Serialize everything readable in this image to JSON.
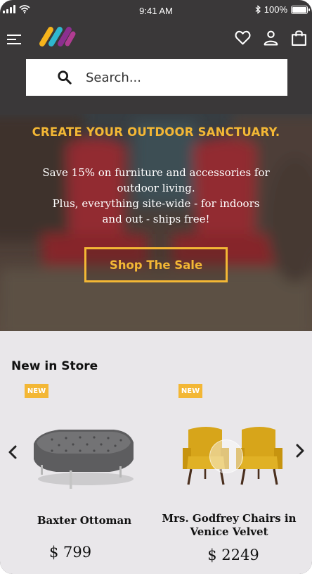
{
  "status_bar": {
    "time": "9:41 AM",
    "battery_text": "100%",
    "battery_level": 1.0
  },
  "nav": {
    "icons": [
      "menu-icon",
      "brand-logo",
      "heart-icon",
      "user-icon",
      "shopping-bag-icon"
    ]
  },
  "search": {
    "placeholder": "Search..."
  },
  "hero": {
    "title": "CREATE YOUR OUTDOOR SANCTUARY.",
    "line1": "Save 15% on furniture  and accessories for",
    "line2": "outdoor living.",
    "line3": "Plus, everything site-wide - for indoors",
    "line4": "and out - ships free!",
    "cta": "Shop The Sale"
  },
  "colors": {
    "accent": "#f3b735",
    "header_bg": "#3a3839",
    "section_bg": "#e9e7ea"
  },
  "products_section": {
    "title": "New in Store",
    "items": [
      {
        "badge": "NEW",
        "name_line1": "Baxter Ottoman",
        "name_line2": "",
        "price": "$ 799",
        "image_icon": "gray-tufted-ottoman"
      },
      {
        "badge": "NEW",
        "name_line1": "Mrs. Godfrey Chairs in",
        "name_line2": "Venice Velvet",
        "price": "$ 2249",
        "image_icon": "yellow-velvet-chairs"
      }
    ]
  }
}
